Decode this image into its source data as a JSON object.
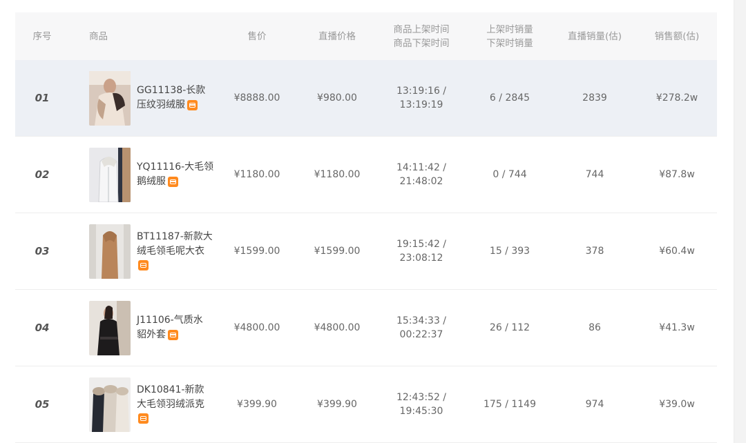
{
  "header": {
    "index": "序号",
    "product": "商品",
    "price": "售价",
    "live_price": "直播价格",
    "list_time": "商品上架时间",
    "delist_time": "商品下架时间",
    "list_sales": "上架时销量",
    "delist_sales": "下架时销量",
    "live_sales": "直播销量(估)",
    "amount": "销售额(估)"
  },
  "rows": [
    {
      "no": "01",
      "name": "GG11138-长款",
      "name2": "压纹羽绒服",
      "price": "¥8888.00",
      "live_price": "¥980.00",
      "time_on": "13:19:16 /",
      "time_off": "13:19:19",
      "sales": "6 / 2845",
      "live_sales": "2839",
      "amount": "¥278.2w",
      "thumb": "light-coat-fur",
      "highlight": true
    },
    {
      "no": "02",
      "name": "YQ11116-大毛领",
      "name2": "鹅绒服",
      "price": "¥1180.00",
      "live_price": "¥1180.00",
      "time_on": "14:11:42 /",
      "time_off": "21:48:02",
      "sales": "0 / 744",
      "live_sales": "744",
      "amount": "¥87.8w",
      "thumb": "white-down-coat",
      "highlight": false
    },
    {
      "no": "03",
      "name": "BT11187-新款大",
      "name2": "绒毛领毛呢大衣",
      "price": "¥1599.00",
      "live_price": "¥1599.00",
      "time_on": "19:15:42 /",
      "time_off": "23:08:12",
      "sales": "15 / 393",
      "live_sales": "378",
      "amount": "¥60.4w",
      "thumb": "camel-long-coat",
      "highlight": false
    },
    {
      "no": "04",
      "name": "J11106-气质水",
      "name2": "貂外套",
      "price": "¥4800.00",
      "live_price": "¥4800.00",
      "time_on": "15:34:33 /",
      "time_off": "00:22:37",
      "sales": "26 / 112",
      "live_sales": "86",
      "amount": "¥41.3w",
      "thumb": "black-mink-coat",
      "highlight": false
    },
    {
      "no": "05",
      "name": "DK10841-新款",
      "name2": "大毛领羽绒派克",
      "price": "¥399.90",
      "live_price": "¥399.90",
      "time_on": "12:43:52 /",
      "time_off": "19:45:30",
      "sales": "175 / 1149",
      "live_sales": "974",
      "amount": "¥39.0w",
      "thumb": "parka-set",
      "highlight": false
    }
  ]
}
